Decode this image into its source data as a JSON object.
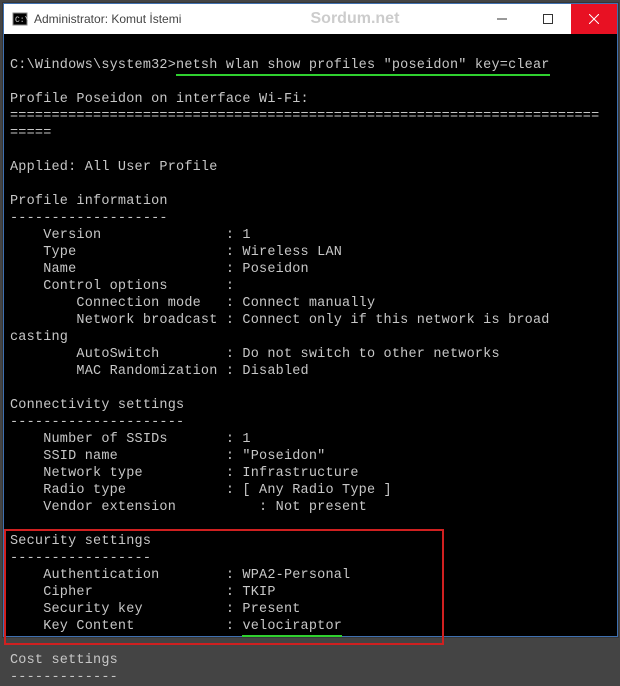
{
  "titlebar": {
    "title": "Administrator: Komut İstemi",
    "watermark": "Sordum.net"
  },
  "prompt": {
    "path": "C:\\Windows\\system32>",
    "command": "netsh wlan show profiles \"poseidon\" key=clear"
  },
  "profile_header_line": "Profile Poseidon on interface Wi-Fi:",
  "profile_header_rule": "=======================================================================",
  "applied_line": "Applied: All User Profile",
  "sections": {
    "profile_info": {
      "title": "Profile information",
      "rule": "-------------------",
      "rows": [
        {
          "k": "    Version               ",
          "v": ": 1"
        },
        {
          "k": "    Type                  ",
          "v": ": Wireless LAN"
        },
        {
          "k": "    Name                  ",
          "v": ": Poseidon"
        },
        {
          "k": "    Control options       ",
          "v": ":"
        },
        {
          "k": "        Connection mode   ",
          "v": ": Connect manually"
        },
        {
          "k": "        Network broadcast ",
          "v": ": Connect only if this network is broadcasting"
        },
        {
          "k": "        AutoSwitch        ",
          "v": ": Do not switch to other networks"
        },
        {
          "k": "        MAC Randomization ",
          "v": ": Disabled"
        }
      ]
    },
    "connectivity": {
      "title": "Connectivity settings",
      "rule": "---------------------",
      "rows": [
        {
          "k": "    Number of SSIDs       ",
          "v": ": 1"
        },
        {
          "k": "    SSID name             ",
          "v": ": \"Poseidon\""
        },
        {
          "k": "    Network type          ",
          "v": ": Infrastructure"
        },
        {
          "k": "    Radio type            ",
          "v": ": [ Any Radio Type ]"
        },
        {
          "k": "    Vendor extension      ",
          "v": "    : Not present"
        }
      ]
    },
    "security": {
      "title": "Security settings",
      "rule": "-----------------",
      "rows": [
        {
          "k": "    Authentication        ",
          "v": ": WPA2-Personal"
        },
        {
          "k": "    Cipher                ",
          "v": ": TKIP"
        },
        {
          "k": "    Security key          ",
          "v": ": Present"
        },
        {
          "k": "    Key Content           ",
          "v": ": ",
          "highlighted": "velociraptor"
        }
      ]
    },
    "cost": {
      "title": "Cost settings",
      "rule": "-------------"
    }
  }
}
